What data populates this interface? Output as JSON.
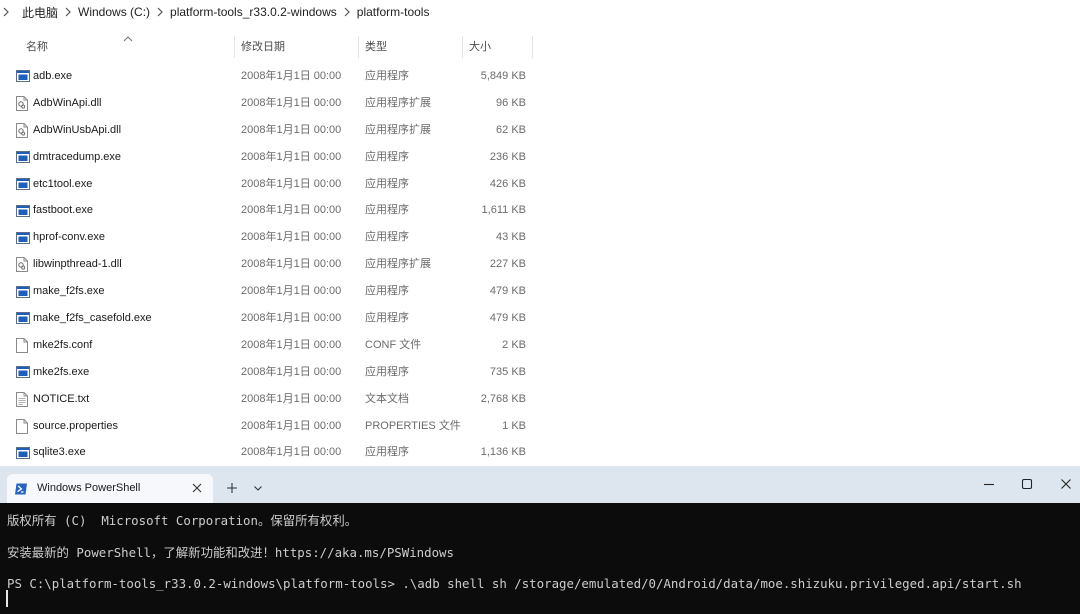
{
  "breadcrumb": {
    "items": [
      "此电脑",
      "Windows (C:)",
      "platform-tools_r33.0.2-windows",
      "platform-tools"
    ]
  },
  "columns": {
    "name": "名称",
    "date": "修改日期",
    "type": "类型",
    "size": "大小"
  },
  "files": [
    {
      "name": "adb.exe",
      "date": "2008年1月1日 00:00",
      "type": "应用程序",
      "size": "5,849 KB",
      "icon": "exe-icon"
    },
    {
      "name": "AdbWinApi.dll",
      "date": "2008年1月1日 00:00",
      "type": "应用程序扩展",
      "size": "96 KB",
      "icon": "dll-icon"
    },
    {
      "name": "AdbWinUsbApi.dll",
      "date": "2008年1月1日 00:00",
      "type": "应用程序扩展",
      "size": "62 KB",
      "icon": "dll-icon"
    },
    {
      "name": "dmtracedump.exe",
      "date": "2008年1月1日 00:00",
      "type": "应用程序",
      "size": "236 KB",
      "icon": "exe-icon"
    },
    {
      "name": "etc1tool.exe",
      "date": "2008年1月1日 00:00",
      "type": "应用程序",
      "size": "426 KB",
      "icon": "exe-icon"
    },
    {
      "name": "fastboot.exe",
      "date": "2008年1月1日 00:00",
      "type": "应用程序",
      "size": "1,611 KB",
      "icon": "exe-icon"
    },
    {
      "name": "hprof-conv.exe",
      "date": "2008年1月1日 00:00",
      "type": "应用程序",
      "size": "43 KB",
      "icon": "exe-icon"
    },
    {
      "name": "libwinpthread-1.dll",
      "date": "2008年1月1日 00:00",
      "type": "应用程序扩展",
      "size": "227 KB",
      "icon": "dll-icon"
    },
    {
      "name": "make_f2fs.exe",
      "date": "2008年1月1日 00:00",
      "type": "应用程序",
      "size": "479 KB",
      "icon": "exe-icon"
    },
    {
      "name": "make_f2fs_casefold.exe",
      "date": "2008年1月1日 00:00",
      "type": "应用程序",
      "size": "479 KB",
      "icon": "exe-icon"
    },
    {
      "name": "mke2fs.conf",
      "date": "2008年1月1日 00:00",
      "type": "CONF 文件",
      "size": "2 KB",
      "icon": "file-icon"
    },
    {
      "name": "mke2fs.exe",
      "date": "2008年1月1日 00:00",
      "type": "应用程序",
      "size": "735 KB",
      "icon": "exe-icon"
    },
    {
      "name": "NOTICE.txt",
      "date": "2008年1月1日 00:00",
      "type": "文本文档",
      "size": "2,768 KB",
      "icon": "text-file-icon"
    },
    {
      "name": "source.properties",
      "date": "2008年1月1日 00:00",
      "type": "PROPERTIES 文件",
      "size": "1 KB",
      "icon": "file-icon"
    },
    {
      "name": "sqlite3.exe",
      "date": "2008年1月1日 00:00",
      "type": "应用程序",
      "size": "1,136 KB",
      "icon": "exe-icon"
    }
  ],
  "terminal": {
    "tab_title": "Windows PowerShell",
    "lines": [
      "版权所有 (C)  Microsoft Corporation。保留所有权利。",
      "安装最新的 PowerShell，了解新功能和改进！https://aka.ms/PSWindows",
      "PS C:\\platform-tools_r33.0.2-windows\\platform-tools> .\\adb shell sh /storage/emulated/0/Android/data/moe.shizuku.privileged.api/start.sh"
    ]
  },
  "colors": {
    "terminal_bg": "#0c0c0c",
    "terminal_text": "#cccccc",
    "tabbar_bg": "#dde6ef",
    "exe_icon_blue": "#1f5fb8"
  }
}
